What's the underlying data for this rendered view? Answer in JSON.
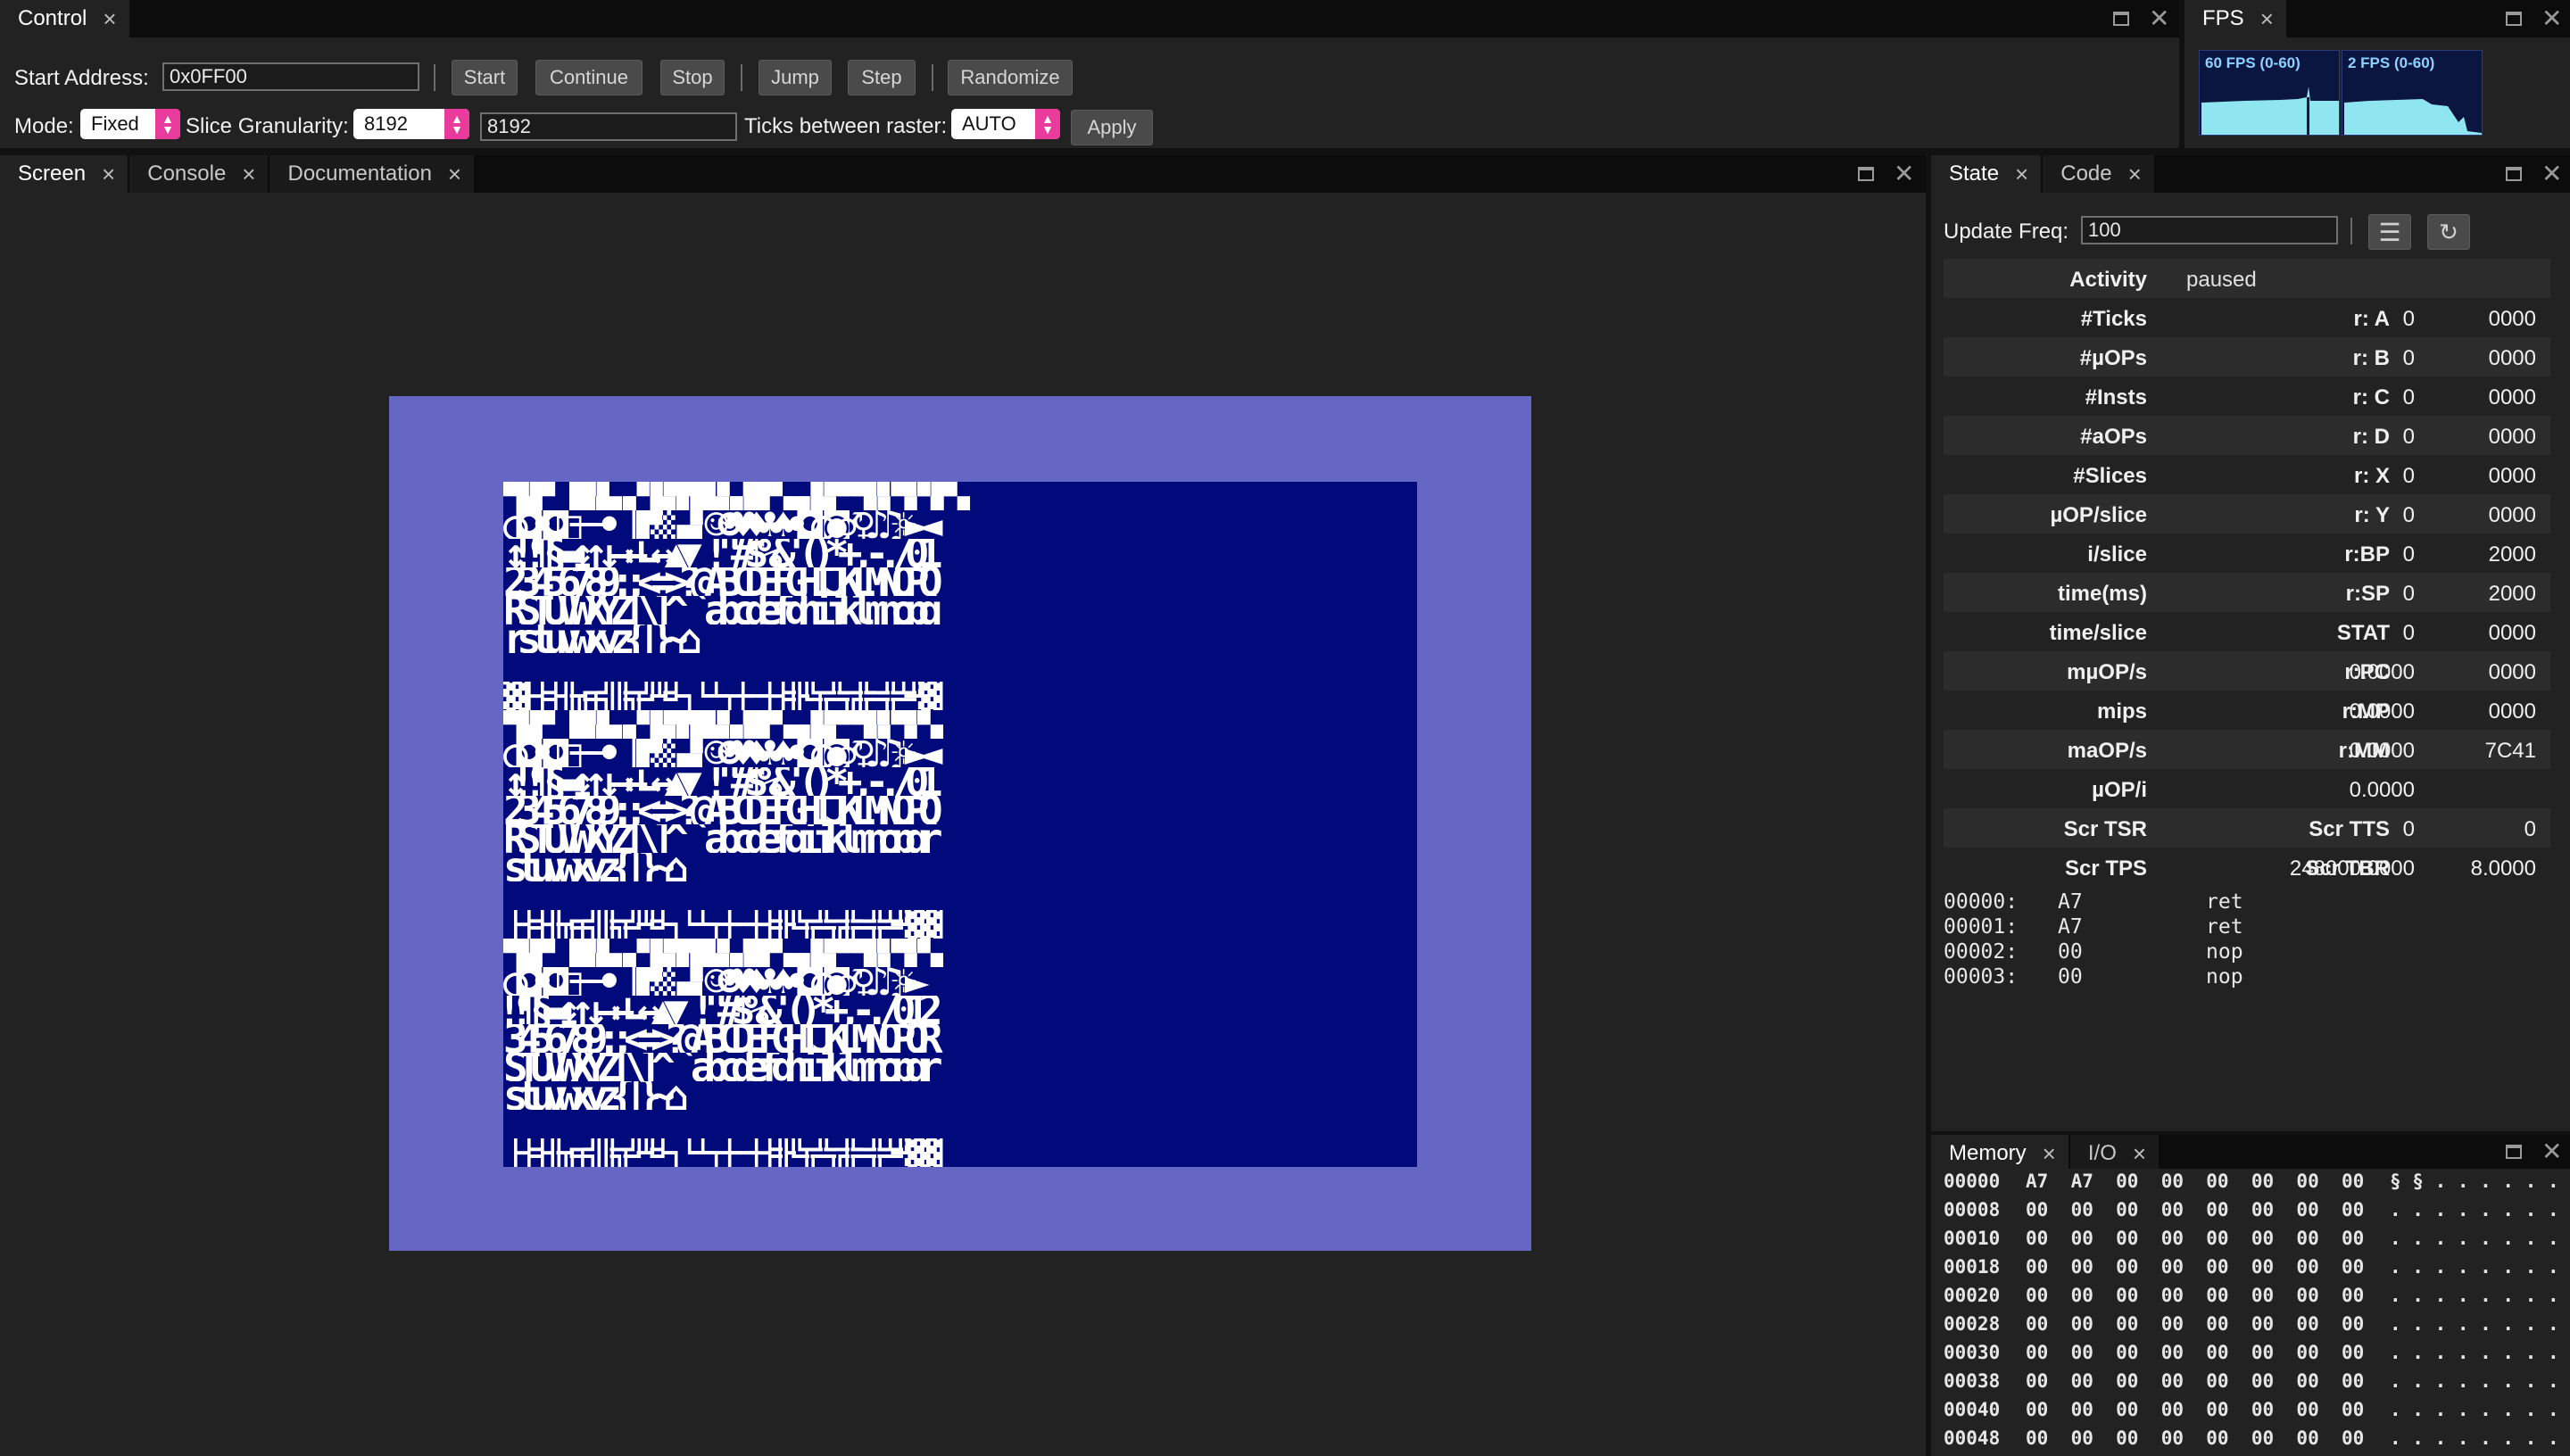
{
  "control": {
    "tab_label": "Control",
    "start_address_label": "Start Address:",
    "start_address_value": "0x0FF00",
    "buttons": [
      "Start",
      "Continue",
      "Stop",
      "Jump",
      "Step",
      "Randomize"
    ],
    "mode_label": "Mode:",
    "mode_value": "Fixed",
    "slice_label": "Slice Granularity:",
    "slice_value": "8192",
    "slice_text": "8192",
    "ticks_label": "Ticks between raster:",
    "ticks_value": "AUTO",
    "apply_label": "Apply"
  },
  "fps": {
    "tab_label": "FPS",
    "graph1_label": "60 FPS (0-60)",
    "graph2_label": "2 FPS (0-60)"
  },
  "screen_tabs": [
    "Screen",
    "Console",
    "Documentation"
  ],
  "screen": {
    "border_color": "#6666c4",
    "bg_color": "#000a7a",
    "fg_color": "#ffffff",
    "text_lines": [
      "▀▙▛ ▐█▚▙▗▖▘▙▜▀█▄▚▞█▛▗▄▖▙▀▀▜▞▖▀▞▚▛▚",
      "○◘•◘□──•▕▐▛▒▁▄▘☺☻♥♦♣♠•◘○◙♂♀♪♫☼►◄",
      "↕‼¶§▬↨↑↓→←∟↔▲▼ !\"#$%&'()*+,-./01",
      "23456789:;<=>?@ABCDEFGHIJKLMNOPQ",
      "RSTUVWXYZ[\\]^_`abcdefghijklmnopq",
      "rstuvwxyz{|}~⌂",
      "",
      "▓│┤╡╢╖╕╣║╗╝╜╛┐└┴┬├─┼╞╟╚╔╩╦╠═╬╧╨▓",
      "▀▙▛ ▐█▚▙▗▖▘▙▜▀█▄▚▞█▛▗▄▖▙▀▀▜▞▖▀▞▚",
      "○◘•◘□──•▕▐▛▒▁▄▘☺☻♥♦♣♠•◘○◙♂♀♪♫☼►◄",
      "↕‼¶§▬↨↑↓→←∟↔▲▼ !\"#$%&'()*+,-./01",
      "23456789:;<=>?@ABCDEFGHIJKLMNOPQ",
      "RSTUVWXYZ[\\]^_`abcdefgijklmnopqr",
      "stuvwxyz{|}~⌂",
      "",
      "│┤╡╢╖╕╣║╗╝╜╛┐└┴┬├─┼╞╟╚╔╩╦╠═╬╧╨▓▓",
      "▀▙▛ ▐█▚▙▗▖▘▙▜▀█▄▚▞█▛▗▄▖▙▀▀▜▞▖▀▞▚",
      "○◘•◘□──•▕▐▛▒▁▄▘☺☻♥♦♣♠•◘○◙♂♀♪♫☼►",
      "‼¶§▬↨↑↓→←∟↔▲▼ !\"#$%&'()*+,-./012",
      "3456789:;<=>?@ABCDEFGHIJKLMNOPQR",
      "STUVWXYZ[\\]^_`abcdefghijklmnopqr",
      "stuvwxyz{|}~⌂",
      "",
      "│┤╡╢╖╕╣║╗╝╜╛┐└┴┬├─┼╞╟╚╔╩╦╠═╬╧╨▓▓"
    ]
  },
  "state_tabs": [
    "State",
    "Code"
  ],
  "state": {
    "update_freq_label": "Update Freq:",
    "update_freq_value": "100",
    "activity_label": "Activity",
    "activity_value": "paused",
    "rows": [
      {
        "k1": "#Ticks",
        "v1": "0",
        "k2": "r: A",
        "v2": "0000"
      },
      {
        "k1": "#µOPs",
        "v1": "0",
        "k2": "r: B",
        "v2": "0000"
      },
      {
        "k1": "#Insts",
        "v1": "0",
        "k2": "r: C",
        "v2": "0000"
      },
      {
        "k1": "#aOPs",
        "v1": "0",
        "k2": "r: D",
        "v2": "0000"
      },
      {
        "k1": "#Slices",
        "v1": "0",
        "k2": "r: X",
        "v2": "0000"
      },
      {
        "k1": "µOP/slice",
        "v1": "0",
        "k2": "r: Y",
        "v2": "0000"
      },
      {
        "k1": "i/slice",
        "v1": "0",
        "k2": "r:BP",
        "v2": "2000"
      },
      {
        "k1": "time(ms)",
        "v1": "0",
        "k2": "r:SP",
        "v2": "2000"
      },
      {
        "k1": "time/slice",
        "v1": "0",
        "k2": "STAT",
        "v2": "0000"
      },
      {
        "k1": "mµOP/s",
        "v1": "0.0000",
        "k2": "r:PC",
        "v2": "0000"
      },
      {
        "k1": "mips",
        "v1": "0.0000",
        "k2": "r:MP",
        "v2": "0000"
      },
      {
        "k1": "maOP/s",
        "v1": "0.0000",
        "k2": "r:MM",
        "v2": "7C41"
      },
      {
        "k1": "µOP/i",
        "v1": "0.0000",
        "k2": "",
        "v2": ""
      },
      {
        "k1": "Scr TSR",
        "v1": "0",
        "k2": "Scr TTS",
        "v2": "0"
      },
      {
        "k1": "Scr TPS",
        "v1": "248000.0000",
        "k2": "Scr TBR",
        "v2": "8.0000"
      }
    ],
    "disasm": [
      {
        "addr": "00000:",
        "byte": "A7",
        "op": "ret"
      },
      {
        "addr": "00001:",
        "byte": "A7",
        "op": "ret"
      },
      {
        "addr": "00002:",
        "byte": "00",
        "op": "nop"
      },
      {
        "addr": "00003:",
        "byte": "00",
        "op": "nop"
      }
    ]
  },
  "memory_tabs": [
    "Memory",
    "I/O"
  ],
  "memory": [
    {
      "addr": "00000",
      "bytes": "A7  A7  00  00  00  00  00  00",
      "ascii": "§ § . . . . . ."
    },
    {
      "addr": "00008",
      "bytes": "00  00  00  00  00  00  00  00",
      "ascii": ". . . . . . . ."
    },
    {
      "addr": "00010",
      "bytes": "00  00  00  00  00  00  00  00",
      "ascii": ". . . . . . . ."
    },
    {
      "addr": "00018",
      "bytes": "00  00  00  00  00  00  00  00",
      "ascii": ". . . . . . . ."
    },
    {
      "addr": "00020",
      "bytes": "00  00  00  00  00  00  00  00",
      "ascii": ". . . . . . . ."
    },
    {
      "addr": "00028",
      "bytes": "00  00  00  00  00  00  00  00",
      "ascii": ". . . . . . . ."
    },
    {
      "addr": "00030",
      "bytes": "00  00  00  00  00  00  00  00",
      "ascii": ". . . . . . . ."
    },
    {
      "addr": "00038",
      "bytes": "00  00  00  00  00  00  00  00",
      "ascii": ". . . . . . . ."
    },
    {
      "addr": "00040",
      "bytes": "00  00  00  00  00  00  00  00",
      "ascii": ". . . . . . . ."
    },
    {
      "addr": "00048",
      "bytes": "00  00  00  00  00  00  00  00",
      "ascii": ". . . . . . . ."
    }
  ]
}
